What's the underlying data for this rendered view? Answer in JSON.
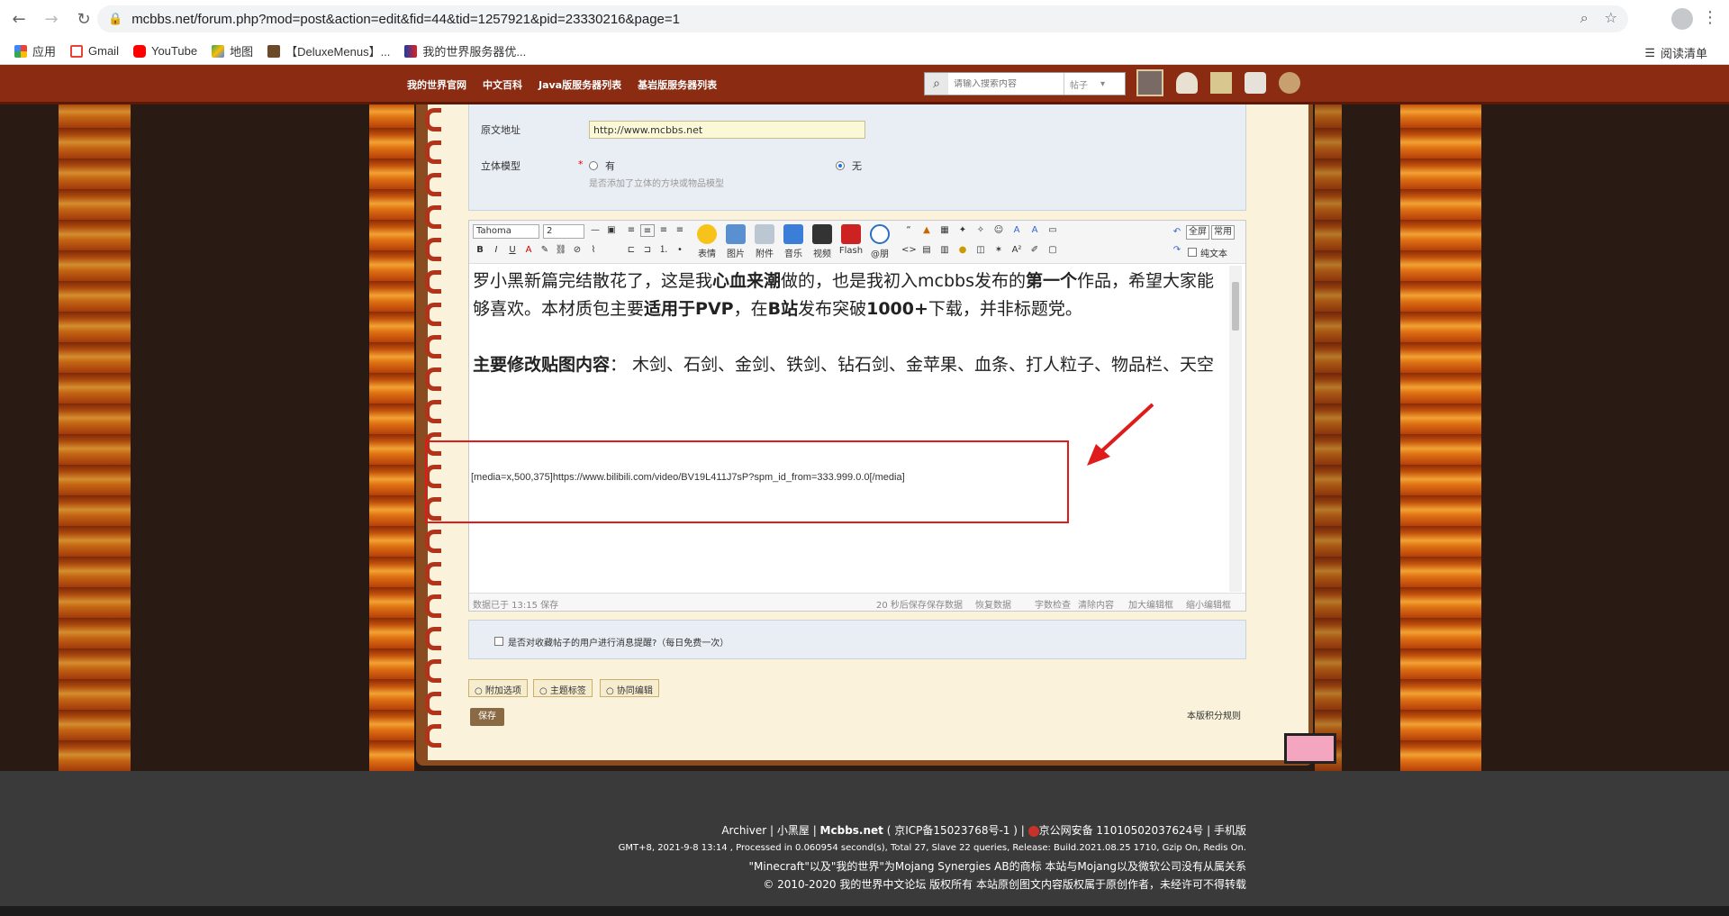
{
  "browser": {
    "url": "mcbbs.net/forum.php?mod=post&action=edit&fid=44&tid=1257921&pid=23330216&page=1",
    "bookmarks": [
      "应用",
      "Gmail",
      "YouTube",
      "地图",
      "【DeluxeMenus】...",
      "我的世界服务器优..."
    ],
    "reading_list": "阅读清单"
  },
  "site_nav": {
    "links": [
      "我的世界官网",
      "中文百科",
      "Java版服务器列表",
      "基岩版服务器列表"
    ],
    "search_placeholder": "请输入搜索内容",
    "search_type": "帖子"
  },
  "form": {
    "source_label": "原文地址",
    "source_value": "http://www.mcbbs.net",
    "model_label": "立体模型",
    "required_mark": "*",
    "option_yes": "有",
    "option_no": "无",
    "model_hint": "是否添加了立体的方块或物品模型"
  },
  "toolbar": {
    "font": "Tahoma",
    "size": "2",
    "buttons": [
      "表情",
      "图片",
      "附件",
      "音乐",
      "视频",
      "Flash",
      "@朋"
    ],
    "fullscreen": "全屏",
    "common": "常用",
    "plaintext": "纯文本"
  },
  "content": {
    "p1_a": "罗小黑新篇完结散花了，这是我",
    "p1_b": "心血来潮",
    "p1_c": "做的，也是我初入mcbbs发布的",
    "p1_d": "第一个",
    "p1_e": "作品，希望大家能够喜欢。本材质包主要",
    "p1_f": "适用于PVP",
    "p1_g": "，在",
    "p1_h": "B站",
    "p1_i": "发布突破",
    "p1_j": "1000+",
    "p1_k": "下载，并非标题党。",
    "p2_a": "主要修改贴图内容",
    "p2_b": "：  木剑、石剑、金剑、铁剑、钻石剑、金苹果、血条、打人粒子、物品栏、天空",
    "media": "[media=x,500,375]https://www.bilibili.com/video/BV19L411J7sP?spm_id_from=333.999.0.0[/media]"
  },
  "editor_footer": {
    "saved": "数据已于 13:15 保存",
    "autosave": "20 秒后保存",
    "save_data": "保存数据",
    "restore": "恢复数据",
    "word_check": "字数检查",
    "clear": "清除内容",
    "enlarge": "加大编辑框",
    "shrink": "缩小编辑框"
  },
  "notice": {
    "text": "是否对收藏帖子的用户进行消息提醒?（每日免费一次）"
  },
  "tabs": [
    "附加选项",
    "主题标签",
    "协同编辑"
  ],
  "save_label": "保存",
  "rules_link": "本版积分规则",
  "footer": {
    "line1_a": "Archiver",
    "line1_b": "小黑屋",
    "line1_c": "Mcbbs.net",
    "line1_d": "( 京ICP备15023768号-1 )",
    "line1_e": "京公网安备 11010502037624号",
    "line1_f": "手机版",
    "line2": "GMT+8, 2021-9-8 13:14 , Processed in 0.060954 second(s), Total 27, Slave 22 queries, Release: Build.2021.08.25 1710, Gzip On, Redis On.",
    "line3": "\"Minecraft\"以及\"我的世界\"为Mojang Synergies AB的商标 本站与Mojang以及微软公司没有从属关系",
    "line4": "© 2010-2020 我的世界中文论坛 版权所有 本站原创图文内容版权属于原创作者，未经许可不得转载"
  },
  "colors": {
    "accent_red": "#e01b1b",
    "nav_bg": "#8a2b12",
    "page_bg": "#fbf2dc"
  }
}
